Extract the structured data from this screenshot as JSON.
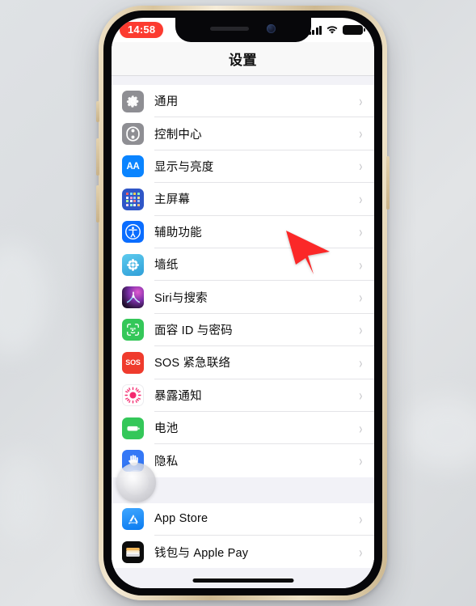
{
  "device": {
    "frame_color": "#d8c49c",
    "bezel_color": "#07070a"
  },
  "status_bar": {
    "time": "14:58",
    "time_badge_color": "#fc3b30",
    "icons": [
      "cellular-signal-icon",
      "wifi-icon",
      "battery-icon"
    ]
  },
  "nav": {
    "title": "设置"
  },
  "groups": [
    {
      "items": [
        {
          "label": "通用",
          "icon": "gear-icon",
          "color": "#8e8e93"
        },
        {
          "label": "控制中心",
          "icon": "sliders-icon",
          "color": "#8e8e93"
        },
        {
          "label": "显示与亮度",
          "icon": "aa-text-size-icon",
          "color": "#0a84ff"
        },
        {
          "label": "主屏幕",
          "icon": "home-screen-grid-icon",
          "color": "#2f56c7"
        },
        {
          "label": "辅助功能",
          "icon": "accessibility-icon",
          "color": "#0a6dff"
        },
        {
          "label": "墙纸",
          "icon": "wallpaper-flower-icon",
          "color": "#45b8e6"
        },
        {
          "label": "Siri与搜索",
          "icon": "siri-icon",
          "color": "#2b1b44"
        },
        {
          "label": "面容 ID 与密码",
          "icon": "face-id-icon",
          "color": "#34c759"
        },
        {
          "label": "SOS 紧急联络",
          "icon": "sos-icon",
          "color": "#ef3b2d"
        },
        {
          "label": "暴露通知",
          "icon": "exposure-notification-icon",
          "color": "#ffffff"
        },
        {
          "label": "电池",
          "icon": "battery-green-icon",
          "color": "#34c759"
        },
        {
          "label": "隐私",
          "icon": "privacy-hand-icon",
          "color": "#3478f6"
        }
      ]
    },
    {
      "items": [
        {
          "label": "App Store",
          "icon": "app-store-icon",
          "color": "#1e8fff"
        },
        {
          "label": "钱包与 Apple Pay",
          "icon": "wallet-icon",
          "color": "#0c0c0c"
        }
      ]
    }
  ],
  "overlays": {
    "assistive_touch": "assistive-touch-button",
    "cursor": "mouse-cursor-arrow",
    "cursor_color": "#fb2828",
    "home_indicator": "home-indicator-bar"
  }
}
